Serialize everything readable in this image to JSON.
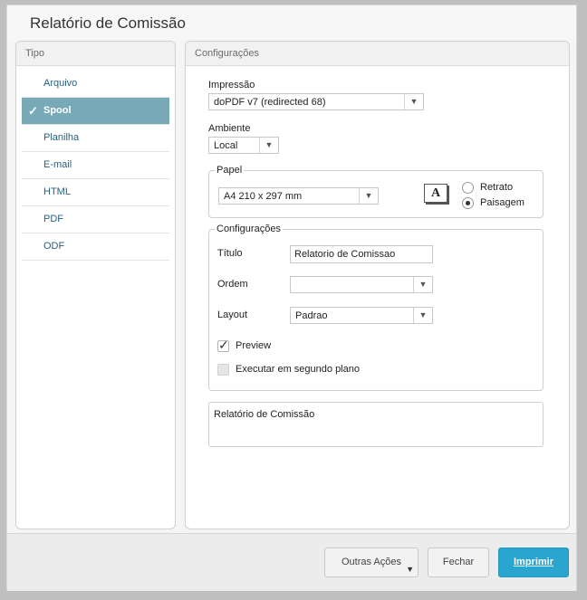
{
  "window": {
    "title": "Relatório de Comissão"
  },
  "tipo": {
    "header": "Tipo",
    "items": [
      {
        "label": "Arquivo",
        "active": false
      },
      {
        "label": "Spool",
        "active": true
      },
      {
        "label": "Planilha",
        "active": false
      },
      {
        "label": "E-mail",
        "active": false
      },
      {
        "label": "HTML",
        "active": false
      },
      {
        "label": "PDF",
        "active": false
      },
      {
        "label": "ODF",
        "active": false
      }
    ]
  },
  "config": {
    "header": "Configurações",
    "impressao": {
      "label": "Impressão",
      "value": "doPDF v7 (redirected 68)"
    },
    "ambiente": {
      "label": "Ambiente",
      "value": "Local"
    },
    "papel": {
      "legend": "Papel",
      "size": "A4 210 x 297 mm",
      "orientation": {
        "retrato": "Retrato",
        "paisagem": "Paisagem",
        "selected": "Paisagem"
      }
    },
    "group": {
      "legend": "Configurações",
      "titulo_label": "Título",
      "titulo_value": "Relatorio de Comissao",
      "ordem_label": "Ordem",
      "ordem_value": "",
      "layout_label": "Layout",
      "layout_value": "Padrao",
      "preview_label": "Preview",
      "preview_checked": true,
      "background_label": "Executar em segundo plano",
      "background_checked": false
    },
    "description": "Relatório de Comissão"
  },
  "footer": {
    "outras_acoes": "Outras Ações",
    "fechar": "Fechar",
    "imprimir": "Imprimir"
  },
  "colors": {
    "accent": "#2aa5cf",
    "selected_item": "#77a9b7",
    "link": "#25627f"
  }
}
